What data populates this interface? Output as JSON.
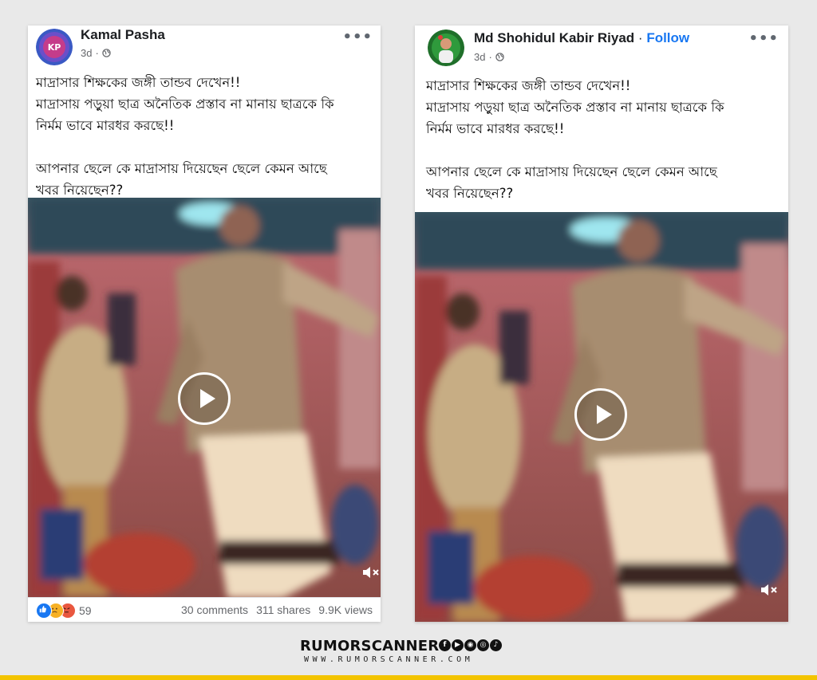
{
  "colors": {
    "background": "#e9e9e9",
    "link": "#1877f2",
    "accent_bar": "#f3c400"
  },
  "posts": [
    {
      "author": "Kamal Pasha",
      "time": "3d",
      "line1": "মাদ্রাসার শিক্ষকের জঙ্গী তান্ডব দেখেন!!",
      "line2": "মাদ্রাসায় পড়ুয়া ছাত্র অনৈতিক প্রস্তাব না মানায় ছাত্রকে কি",
      "line3": "নির্মম ভাবে মারধর করছে!!",
      "line4": "আপনার ছেলে কে মাদ্রাসায় দিয়েছেন ছেলে কেমন আছে",
      "line5": "খবর নিয়েছেন??",
      "reactions": [
        "like",
        "sad",
        "angry"
      ],
      "reaction_count": "59",
      "comments": "30 comments",
      "shares": "311 shares",
      "views": "9.9K views"
    },
    {
      "author": "Md Shohidul Kabir Riyad",
      "separator": "·",
      "follow": "Follow",
      "time": "3d",
      "line1": "মাদ্রাসার শিক্ষকের জঙ্গী তান্ডব দেখেন!!",
      "line2": "মাদ্রাসায় পড়ুয়া ছাত্র অনৈতিক প্রস্তাব না মানায় ছাত্রকে কি",
      "line3": "নির্মম ভাবে মারধর করছে!!",
      "line4": "আপনার ছেলে কে মাদ্রাসায় দিয়েছেন ছেলে কেমন আছে",
      "line5": "খবর নিয়েছেন??"
    }
  ],
  "icons": [
    "more-options-icon",
    "globe-icon",
    "play-icon",
    "muted-speaker-icon"
  ],
  "watermark": {
    "brand": "RUMORSCANNER",
    "url": "WWW.RUMORSCANNER.COM",
    "social": [
      "f",
      "▶",
      "◉",
      "◎",
      "♪"
    ]
  }
}
